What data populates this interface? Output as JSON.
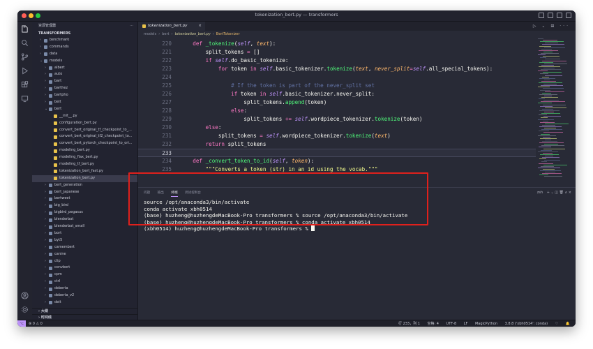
{
  "window": {
    "title": "tokenization_bert.py — transformers"
  },
  "activity_icons": [
    "files-icon",
    "search-icon",
    "source-control-icon",
    "run-debug-icon",
    "extensions-icon",
    "remote-explorer-icon"
  ],
  "activity_bottom_icons": [
    "account-icon",
    "settings-gear-icon"
  ],
  "sidebar": {
    "header": "资源管理器",
    "more": "···",
    "root": "TRANSFORMERS",
    "items": [
      {
        "label": "benchmark",
        "depth": 1,
        "type": "folder",
        "open": false
      },
      {
        "label": "commands",
        "depth": 1,
        "type": "folder",
        "open": false
      },
      {
        "label": "data",
        "depth": 1,
        "type": "folder",
        "open": false
      },
      {
        "label": "models",
        "depth": 1,
        "type": "folder",
        "open": true
      },
      {
        "label": "albert",
        "depth": 2,
        "type": "folder",
        "open": false
      },
      {
        "label": "auto",
        "depth": 2,
        "type": "folder",
        "open": false
      },
      {
        "label": "bart",
        "depth": 2,
        "type": "folder",
        "open": false
      },
      {
        "label": "barthez",
        "depth": 2,
        "type": "folder",
        "open": false
      },
      {
        "label": "bartpho",
        "depth": 2,
        "type": "folder",
        "open": false
      },
      {
        "label": "beit",
        "depth": 2,
        "type": "folder",
        "open": false
      },
      {
        "label": "bert",
        "depth": 2,
        "type": "folder",
        "open": true
      },
      {
        "label": "__init__.py",
        "depth": 3,
        "type": "file"
      },
      {
        "label": "configuration_bert.py",
        "depth": 3,
        "type": "file"
      },
      {
        "label": "convert_bert_original_tf_checkpoint_to_...",
        "depth": 3,
        "type": "file"
      },
      {
        "label": "convert_bert_original_tf2_checkpoint_to...",
        "depth": 3,
        "type": "file"
      },
      {
        "label": "convert_bert_pytorch_checkpoint_to_ori...",
        "depth": 3,
        "type": "file"
      },
      {
        "label": "modeling_bert.py",
        "depth": 3,
        "type": "file"
      },
      {
        "label": "modeling_flax_bert.py",
        "depth": 3,
        "type": "file"
      },
      {
        "label": "modeling_tf_bert.py",
        "depth": 3,
        "type": "file"
      },
      {
        "label": "tokenization_bert_fast.py",
        "depth": 3,
        "type": "file"
      },
      {
        "label": "tokenization_bert.py",
        "depth": 3,
        "type": "file",
        "active": true
      },
      {
        "label": "bert_generation",
        "depth": 2,
        "type": "folder",
        "open": false
      },
      {
        "label": "bert_japanese",
        "depth": 2,
        "type": "folder",
        "open": false
      },
      {
        "label": "bertweet",
        "depth": 2,
        "type": "folder",
        "open": false
      },
      {
        "label": "big_bird",
        "depth": 2,
        "type": "folder",
        "open": false
      },
      {
        "label": "bigbird_pegasus",
        "depth": 2,
        "type": "folder",
        "open": false
      },
      {
        "label": "blenderbot",
        "depth": 2,
        "type": "folder",
        "open": false
      },
      {
        "label": "blenderbot_small",
        "depth": 2,
        "type": "folder",
        "open": false
      },
      {
        "label": "bort",
        "depth": 2,
        "type": "folder",
        "open": false
      },
      {
        "label": "byt5",
        "depth": 2,
        "type": "folder",
        "open": false
      },
      {
        "label": "camembert",
        "depth": 2,
        "type": "folder",
        "open": false
      },
      {
        "label": "canine",
        "depth": 2,
        "type": "folder",
        "open": false
      },
      {
        "label": "clip",
        "depth": 2,
        "type": "folder",
        "open": false
      },
      {
        "label": "convbert",
        "depth": 2,
        "type": "folder",
        "open": false
      },
      {
        "label": "cpm",
        "depth": 2,
        "type": "folder",
        "open": false
      },
      {
        "label": "ctrl",
        "depth": 2,
        "type": "folder",
        "open": false
      },
      {
        "label": "deberta",
        "depth": 2,
        "type": "folder",
        "open": false
      },
      {
        "label": "deberta_v2",
        "depth": 2,
        "type": "folder",
        "open": false
      },
      {
        "label": "deit",
        "depth": 2,
        "type": "folder",
        "open": false
      }
    ],
    "outline_label": "大纲",
    "timeline_label": "时间线"
  },
  "editor": {
    "tab_label": "tokenization_bert.py",
    "tab_close": "×",
    "editor_actions": "▷ ⌄ ⊞ ···",
    "breadcrumb": [
      "models",
      "bert",
      "tokenization_bert.py",
      "BertTokenizer"
    ],
    "lines": [
      {
        "n": "220",
        "tokens": [
          [
            "    ",
            ""
          ],
          [
            "def",
            "kw"
          ],
          [
            " ",
            ""
          ],
          [
            "_tokenize",
            "fn"
          ],
          [
            "(",
            ""
          ],
          [
            "self",
            "sf"
          ],
          [
            ", ",
            ""
          ],
          [
            "text",
            "pm"
          ],
          [
            "):",
            ""
          ]
        ]
      },
      {
        "n": "221",
        "tokens": [
          [
            "        split_tokens ",
            ""
          ],
          [
            "=",
            "op"
          ],
          [
            " []",
            ""
          ]
        ]
      },
      {
        "n": "222",
        "tokens": [
          [
            "        ",
            ""
          ],
          [
            "if",
            "kw"
          ],
          [
            " ",
            ""
          ],
          [
            "self",
            "sf"
          ],
          [
            ".do_basic_tokenize:",
            ""
          ]
        ]
      },
      {
        "n": "223",
        "tokens": [
          [
            "            ",
            ""
          ],
          [
            "for",
            "kw"
          ],
          [
            " token ",
            ""
          ],
          [
            "in",
            "kw"
          ],
          [
            " ",
            ""
          ],
          [
            "self",
            "sf"
          ],
          [
            ".basic_tokenizer.",
            ""
          ],
          [
            "tokenize",
            "fn"
          ],
          [
            "(",
            ""
          ],
          [
            "text",
            "pm"
          ],
          [
            ", ",
            ""
          ],
          [
            "never_split",
            "pm"
          ],
          [
            "=",
            "op"
          ],
          [
            "self",
            "sf"
          ],
          [
            ".all_special_tokens):",
            ""
          ]
        ]
      },
      {
        "n": "224",
        "tokens": [
          [
            "",
            ""
          ]
        ]
      },
      {
        "n": "225",
        "tokens": [
          [
            "                ",
            ""
          ],
          [
            "# If the token is part of the never_split set",
            "cm"
          ]
        ]
      },
      {
        "n": "226",
        "tokens": [
          [
            "                ",
            ""
          ],
          [
            "if",
            "kw"
          ],
          [
            " token ",
            ""
          ],
          [
            "in",
            "kw"
          ],
          [
            " ",
            ""
          ],
          [
            "self",
            "sf"
          ],
          [
            ".basic_tokenizer.never_split:",
            ""
          ]
        ]
      },
      {
        "n": "227",
        "tokens": [
          [
            "                    split_tokens.",
            ""
          ],
          [
            "append",
            "fn"
          ],
          [
            "(token)",
            ""
          ]
        ]
      },
      {
        "n": "228",
        "tokens": [
          [
            "                ",
            ""
          ],
          [
            "else",
            "kw"
          ],
          [
            ":",
            ""
          ]
        ]
      },
      {
        "n": "229",
        "tokens": [
          [
            "                    split_tokens ",
            ""
          ],
          [
            "+=",
            "op"
          ],
          [
            " ",
            ""
          ],
          [
            "self",
            "sf"
          ],
          [
            ".wordpiece_tokenizer.",
            ""
          ],
          [
            "tokenize",
            "fn"
          ],
          [
            "(token)",
            ""
          ]
        ]
      },
      {
        "n": "230",
        "tokens": [
          [
            "        ",
            ""
          ],
          [
            "else",
            "kw"
          ],
          [
            ":",
            ""
          ]
        ]
      },
      {
        "n": "231",
        "tokens": [
          [
            "            split_tokens ",
            ""
          ],
          [
            "=",
            "op"
          ],
          [
            " ",
            ""
          ],
          [
            "self",
            "sf"
          ],
          [
            ".wordpiece_tokenizer.",
            ""
          ],
          [
            "tokenize",
            "fn"
          ],
          [
            "(",
            ""
          ],
          [
            "text",
            "pm"
          ],
          [
            ")",
            ""
          ]
        ]
      },
      {
        "n": "232",
        "tokens": [
          [
            "        ",
            ""
          ],
          [
            "return",
            "kw"
          ],
          [
            " split_tokens",
            ""
          ]
        ]
      },
      {
        "n": "233",
        "tokens": [
          [
            "",
            ""
          ]
        ],
        "current": true
      },
      {
        "n": "234",
        "tokens": [
          [
            "    ",
            ""
          ],
          [
            "def",
            "kw"
          ],
          [
            " ",
            ""
          ],
          [
            "_convert_token_to_id",
            "fn"
          ],
          [
            "(",
            ""
          ],
          [
            "self",
            "sf"
          ],
          [
            ", ",
            ""
          ],
          [
            "token",
            "pm"
          ],
          [
            "):",
            ""
          ]
        ]
      },
      {
        "n": "235",
        "tokens": [
          [
            "        ",
            ""
          ],
          [
            "\"\"\"Converts a token (str) in an id using the vocab.\"\"\"",
            "st"
          ]
        ]
      }
    ]
  },
  "panel": {
    "tabs": [
      "问题",
      "输出",
      "终端",
      "调试控制台"
    ],
    "active_tab": 2,
    "terminal_name": "zsh",
    "actions": "+ ⌄ ◫ 🗑 ∧ ×",
    "terminal_lines": [
      "source /opt/anaconda3/bin/activate",
      "conda activate xbh0514",
      "(base) huzheng@huzhengdeMacBook-Pro transformers % source /opt/anaconda3/bin/activate",
      "(base) huzheng@huzhengdeMacBook-Pro transformers % conda activate xbh0514",
      "(xbh0514) huzheng@huzhengdeMacBook-Pro transformers % "
    ]
  },
  "statusbar": {
    "remote": "⌥",
    "errors": "⊗ 0 ⚠ 0",
    "position": "行 233，列 1",
    "spaces": "空格: 4",
    "encoding": "UTF-8",
    "eol": "LF",
    "language": "MagicPython",
    "interpreter": "3.8.8 ('xbh0514': conda)",
    "feedback": "♡",
    "bell": "🔔"
  },
  "colors": {
    "background": "#282a36",
    "sidebar": "#222330",
    "keyword": "#ff79c6",
    "function": "#50fa7b",
    "self": "#bd93f9",
    "param": "#ffb86c",
    "comment": "#6272a4",
    "string": "#f1fa8c",
    "highlight_box": "#e0201c"
  }
}
